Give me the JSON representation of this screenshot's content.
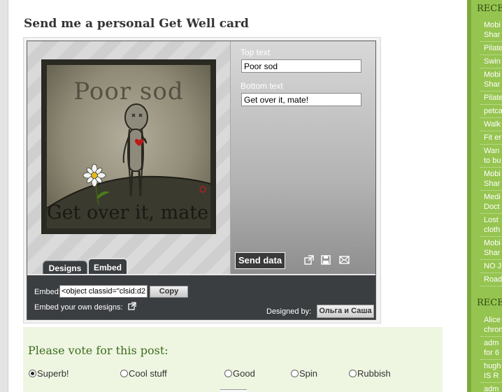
{
  "post": {
    "title": "Send me a personal Get Well card"
  },
  "card_widget": {
    "top_text_label": "Top text",
    "top_text_value": "Poor sod",
    "bottom_text_label": "Bottom text",
    "bottom_text_value": "Get over it, mate!",
    "card_top_text": "Poor sod",
    "card_bottom_text": "Get over it, mate!",
    "send_label": "Send data",
    "tabs": [
      {
        "label": "Designs"
      },
      {
        "label": "Embed"
      }
    ],
    "embed_label": "Embed:",
    "embed_value": "<object classid=\"clsid:d2",
    "copy_label": "Copy",
    "embed_own_label": "Embed your own designs:",
    "designed_by_label": "Designed by:",
    "designer_name": "Ольга и Саша",
    "icons": [
      "popout-icon",
      "save-icon",
      "email-icon",
      "external-link-icon"
    ]
  },
  "vote": {
    "title": "Please vote for this post:",
    "options": [
      {
        "label": "Superb!",
        "selected": true
      },
      {
        "label": "Cool stuff",
        "selected": false
      },
      {
        "label": "Good",
        "selected": false
      },
      {
        "label": "Spin",
        "selected": false
      },
      {
        "label": "Rubbish",
        "selected": false
      }
    ]
  },
  "sidebar": {
    "heading_recent_posts": "RECEN",
    "recent_posts": [
      {
        "lines": [
          "Mobi",
          "Shar"
        ]
      },
      {
        "lines": [
          "Pilate"
        ]
      },
      {
        "lines": [
          "Swin"
        ]
      },
      {
        "lines": [
          "Mobi",
          "Shar"
        ]
      },
      {
        "lines": [
          "Pilate"
        ]
      },
      {
        "lines": [
          "petca"
        ]
      },
      {
        "lines": [
          "Walk"
        ]
      },
      {
        "lines": [
          "Fit er"
        ]
      },
      {
        "lines": [
          "Wan",
          "to bu"
        ]
      },
      {
        "lines": [
          "Mobi",
          "Shar"
        ]
      },
      {
        "lines": [
          "Medi",
          "Doct"
        ]
      },
      {
        "lines": [
          "Lost",
          "cloth"
        ]
      },
      {
        "lines": [
          "Mobi",
          "Shar"
        ]
      },
      {
        "lines": [
          "NO J"
        ]
      },
      {
        "lines": [
          "Road"
        ]
      }
    ],
    "heading_recent_comments": "RECEN",
    "recent_comments": [
      {
        "lines": [
          "Alice",
          "chron"
        ]
      },
      {
        "lines": [
          "adm",
          "for 6"
        ]
      },
      {
        "lines": [
          "hugh",
          "IS R"
        ]
      },
      {
        "lines": [
          "adm"
        ]
      }
    ]
  },
  "colors": {
    "sidebar_green": "#96c450",
    "vote_bg": "#eef6e2",
    "vote_title": "#3e6b1c",
    "widget_dark": "#3b3e41"
  }
}
